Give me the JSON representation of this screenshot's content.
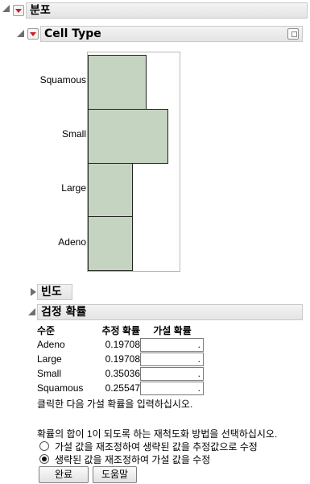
{
  "report": {
    "title": "분포",
    "section_title": "Cell Type"
  },
  "chart_data": {
    "type": "bar",
    "orientation": "horizontal",
    "categories": [
      "Squamous",
      "Small",
      "Large",
      "Adeno"
    ],
    "values": [
      0.255,
      0.35,
      0.197,
      0.197
    ]
  },
  "frequency_section": {
    "title": "빈도"
  },
  "test_probs": {
    "title": "검정 확률",
    "columns": [
      "수준",
      "추정 확률",
      "가설 확률"
    ],
    "rows": [
      {
        "level": "Adeno",
        "estimate": "0.19708",
        "hypothesis": "."
      },
      {
        "level": "Large",
        "estimate": "0.19708",
        "hypothesis": "."
      },
      {
        "level": "Small",
        "estimate": "0.35036",
        "hypothesis": "."
      },
      {
        "level": "Squamous",
        "estimate": "0.25547",
        "hypothesis": "."
      }
    ],
    "instruction": "클릭한 다음 가설 확률을 입력하십시오.",
    "rescale_prompt": "확률의 합이 1이 되도록 하는 재척도화 방법을 선택하십시오.",
    "options": [
      {
        "label": "가설 값을 재조정하여 생략된 값을 추정값으로 수정",
        "selected": false
      },
      {
        "label": "생략된 값을 재조정하여 가설 값을 수정",
        "selected": true
      }
    ],
    "done_button": "완료",
    "help_button": "도움말"
  },
  "colors": {
    "bar_fill": "#c4d4c0",
    "menu_triangle": "#d21a1a"
  }
}
